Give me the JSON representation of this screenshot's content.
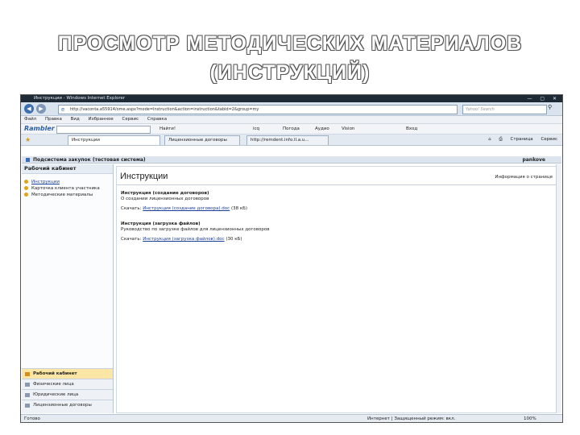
{
  "slide": {
    "title_line1": "ПРОСМОТР МЕТОДИЧЕСКИХ МАТЕРИАЛОВ",
    "title_line2": "(ИНСТРУКЦИЙ)"
  },
  "browser": {
    "window_title": "Инструкции - Windows Internet Explorer",
    "address": "http://vaconta.a55914/ome.aspx?mode=Instruction&action=instruction&tabid=2&group=my",
    "search_placeholder": "Yahoo! Search",
    "menu": [
      "Файл",
      "Правка",
      "Вид",
      "Избранное",
      "Сервис",
      "Справка"
    ],
    "rambler": {
      "logo": "Rambler",
      "buttons": [
        "Найти!",
        "icq",
        "Погода",
        "Аудио",
        "Vision",
        "Вход"
      ]
    },
    "tabs": [
      {
        "label": "Инструкции"
      },
      {
        "label": "Лицензионные договоры"
      },
      {
        "label": "http://remdent.info.ll.a.u..."
      }
    ],
    "tools": [
      "Страница",
      "Сервис"
    ],
    "status": {
      "ready": "Готово",
      "zone": "Интернет | Защищенный режим: вкл.",
      "zoom": "100%"
    }
  },
  "app": {
    "system_title": "Подсистема закупок (тестовая система)",
    "user": "pankove",
    "sidebar": {
      "header": "Рабочий кабинет",
      "items": [
        {
          "label": "Инструкции"
        },
        {
          "label": "Карточка клиента участника"
        },
        {
          "label": "Методические материалы"
        }
      ],
      "bottom": [
        {
          "label": "Рабочий кабинет"
        },
        {
          "label": "Физические лица"
        },
        {
          "label": "Юридические лица"
        },
        {
          "label": "Лицензионные договоры"
        }
      ]
    },
    "main": {
      "title": "Инструкции",
      "page_info": "Информация о странице",
      "entries": [
        {
          "heading": "Инструкция (создание договоров)",
          "description": "О создании лицензионных договоров",
          "download_prefix": "Скачать:",
          "link": "Инструкция (создание договора).doc",
          "size": "(38 кБ)"
        },
        {
          "heading": "Инструкция (загрузка файлов)",
          "description": "Руководство по загрузке файлов для лицензионных договоров",
          "download_prefix": "Скачать:",
          "link": "Инструкция (загрузка файлов).doc",
          "size": "(30 кБ)"
        }
      ]
    }
  }
}
